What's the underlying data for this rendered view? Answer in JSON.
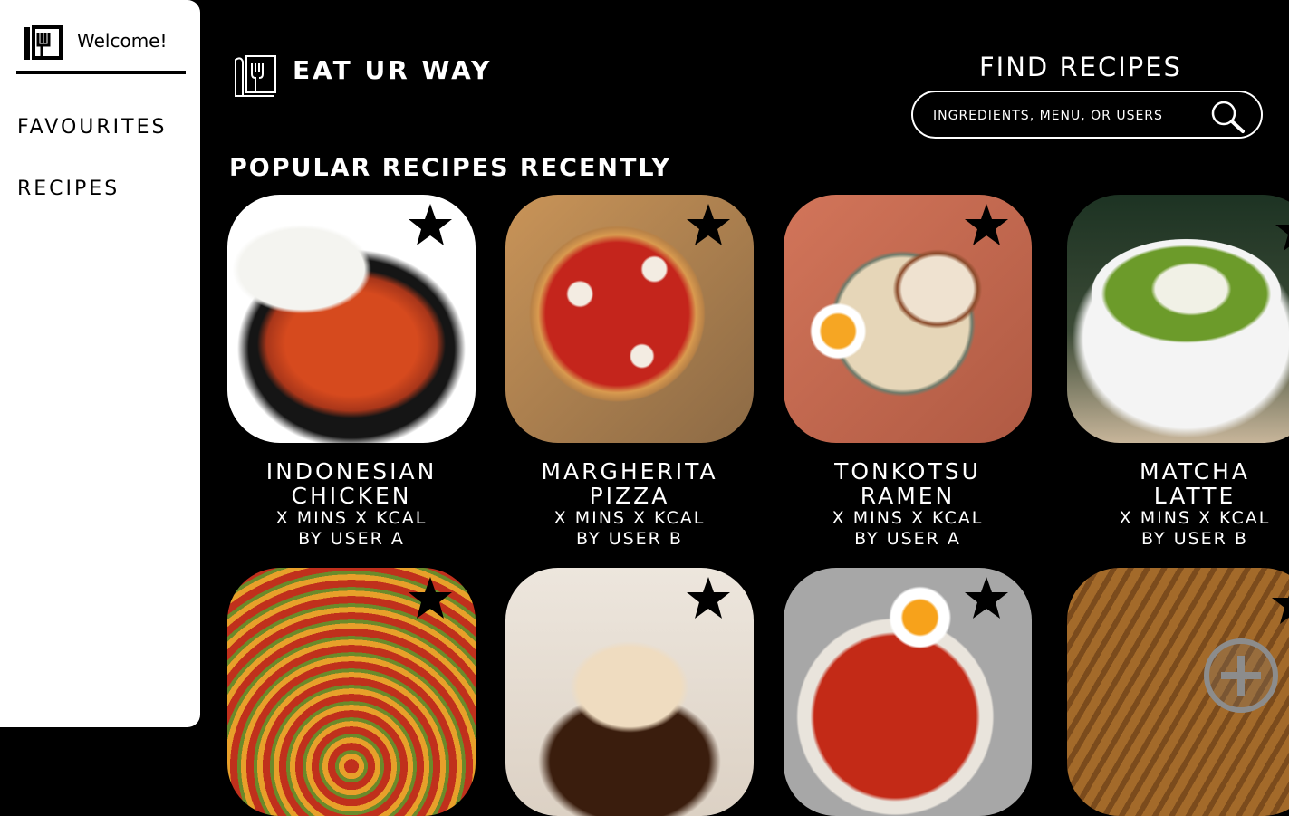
{
  "sidebar": {
    "welcome": "Welcome!",
    "items": [
      {
        "label": "FAVOURITES"
      },
      {
        "label": "RECIPES"
      }
    ]
  },
  "header": {
    "brand": "EAT UR WAY",
    "find_title": "FIND RECIPES",
    "search_placeholder": "INGREDIENTS, MENU, OR USERS"
  },
  "section": {
    "title": "POPULAR RECIPES RECENTLY"
  },
  "recipes": [
    {
      "title_line1": "INDONESIAN",
      "title_line2": "CHICKEN",
      "stats": "X MINS X KCAL",
      "author": "BY USER A"
    },
    {
      "title_line1": "MARGHERITA",
      "title_line2": "PIZZA",
      "stats": "X MINS X KCAL",
      "author": "BY USER B"
    },
    {
      "title_line1": "TONKOTSU",
      "title_line2": "RAMEN",
      "stats": "X MINS X KCAL",
      "author": "BY USER A"
    },
    {
      "title_line1": "MATCHA",
      "title_line2": "LATTE",
      "stats": "X MINS X KCAL",
      "author": "BY USER B"
    }
  ],
  "icons": {
    "logo": "fork-knife-logo-icon",
    "favourite": "star-icon",
    "search": "magnifier-icon",
    "add": "plus-circle-icon"
  },
  "colors": {
    "background": "#000000",
    "sidebar": "#ffffff",
    "text": "#ffffff"
  }
}
